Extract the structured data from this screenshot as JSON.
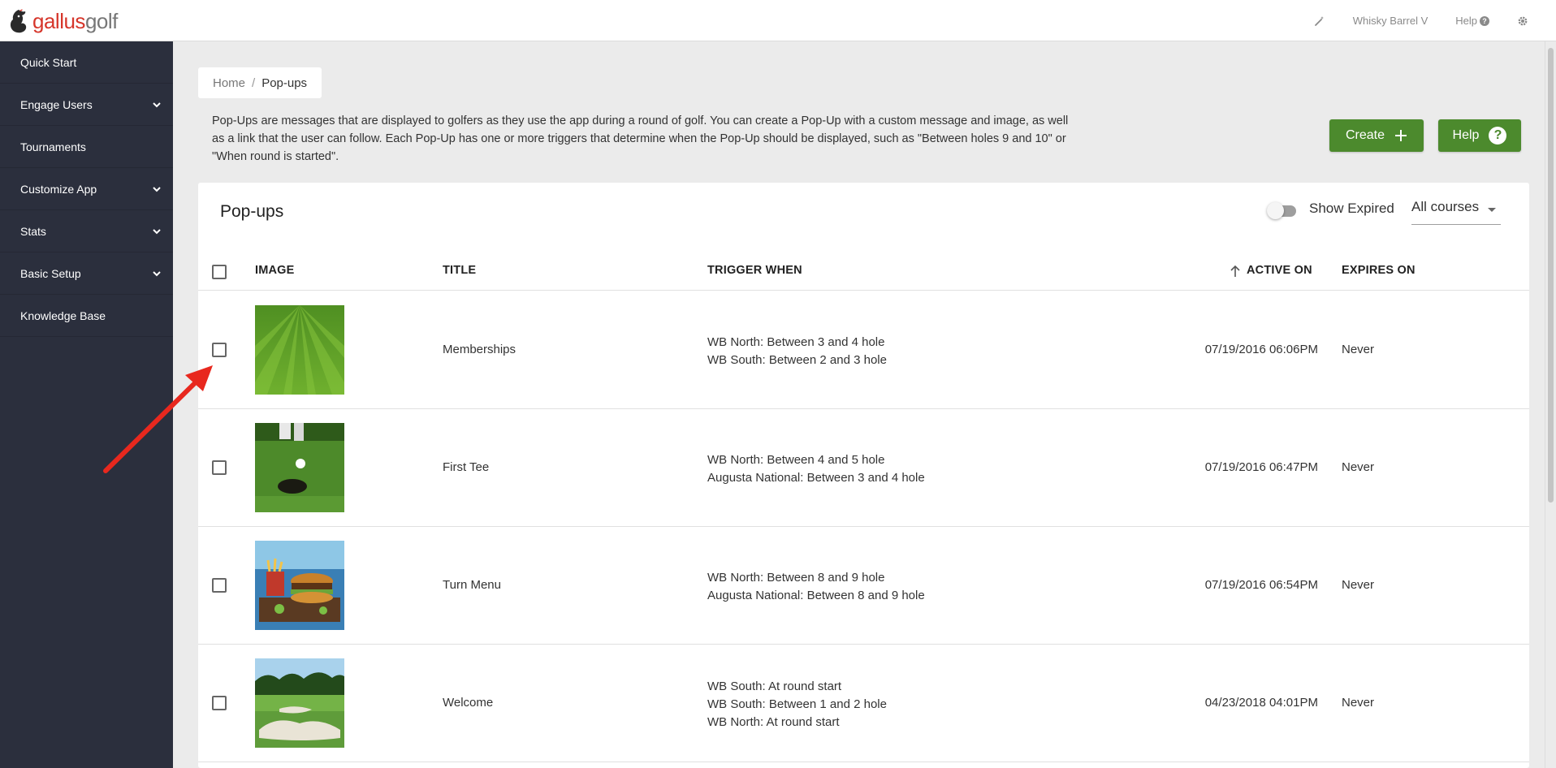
{
  "brand": {
    "part1": "gallus",
    "part2": "golf"
  },
  "topbar": {
    "wand_icon": "magic-wand-icon",
    "account": "Whisky Barrel V",
    "help": "Help",
    "help_glyph": "?",
    "settings_icon": "gear-icon"
  },
  "sidebar": {
    "items": [
      {
        "label": "Quick Start",
        "expandable": false
      },
      {
        "label": "Engage Users",
        "expandable": true
      },
      {
        "label": "Tournaments",
        "expandable": false
      },
      {
        "label": "Customize App",
        "expandable": true
      },
      {
        "label": "Stats",
        "expandable": true
      },
      {
        "label": "Basic Setup",
        "expandable": true
      },
      {
        "label": "Knowledge Base",
        "expandable": false
      }
    ]
  },
  "breadcrumb": {
    "home": "Home",
    "separator": "/",
    "current": "Pop-ups"
  },
  "intro": "Pop-Ups are messages that are displayed to golfers as they use the app during a round of golf. You can create a Pop-Up with a custom message and image, as well as a link that the user can follow. Each Pop-Up has one or more triggers that determine when the Pop-Up should be displayed, such as \"Between holes 9 and 10\" or \"When round is started\".",
  "actions": {
    "create": "Create",
    "help": "Help",
    "help_glyph": "?"
  },
  "card": {
    "title": "Pop-ups",
    "show_expired": "Show Expired",
    "show_expired_on": false,
    "course_filter": "All courses"
  },
  "table": {
    "columns": {
      "image": "IMAGE",
      "title": "TITLE",
      "trigger": "TRIGGER WHEN",
      "active": "ACTIVE ON",
      "expires": "EXPIRES ON"
    },
    "sort_column": "ACTIVE ON",
    "sort_direction": "ascending",
    "rows": [
      {
        "title": "Memberships",
        "triggers": [
          "WB North: Between 3 and 4 hole",
          "WB South: Between 2 and 3 hole"
        ],
        "active": "07/19/2016 06:06PM",
        "expires": "Never",
        "image": "striped-fairway-grass"
      },
      {
        "title": "First Tee",
        "triggers": [
          "WB North: Between 4 and 5 hole",
          "Augusta National: Between 3 and 4 hole"
        ],
        "active": "07/19/2016 06:47PM",
        "expires": "Never",
        "image": "golf-ball-near-hole"
      },
      {
        "title": "Turn Menu",
        "triggers": [
          "WB North: Between 8 and 9 hole",
          "Augusta National: Between 8 and 9 hole"
        ],
        "active": "07/19/2016 06:54PM",
        "expires": "Never",
        "image": "burger-and-fries-plate"
      },
      {
        "title": "Welcome",
        "triggers": [
          "WB South: At round start",
          "WB South: Between 1 and 2 hole",
          "WB North: At round start"
        ],
        "active": "04/23/2018 04:01PM",
        "expires": "Never",
        "image": "golf-course-bunker"
      }
    ]
  },
  "colors": {
    "sidebar": "#2b2f3d",
    "accent_green": "#4c8a2d",
    "brand_red": "#d6362b",
    "annotation_red": "#e8281e"
  }
}
